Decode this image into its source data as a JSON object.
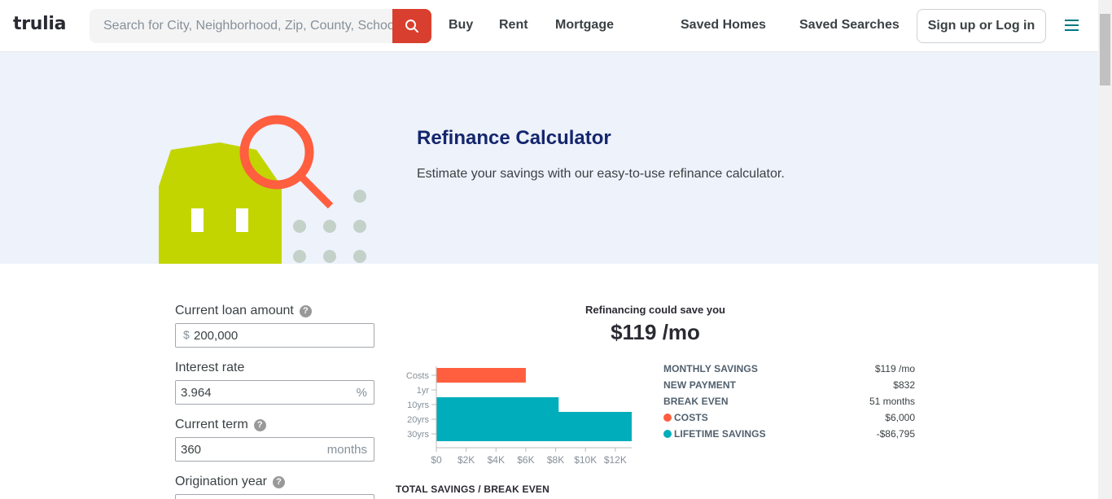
{
  "header": {
    "logo": "trulia",
    "search_placeholder": "Search for City, Neighborhood, Zip, County, School",
    "nav": [
      "Buy",
      "Rent",
      "Mortgage",
      "Saved Homes",
      "Saved Searches"
    ],
    "signup_label": "Sign up or Log in"
  },
  "hero": {
    "title": "Refinance Calculator",
    "subtitle": "Estimate your savings with our easy-to-use refinance calculator."
  },
  "form": {
    "loan_label": "Current loan amount",
    "loan_prefix": "$",
    "loan_value": "200,000",
    "rate_label": "Interest rate",
    "rate_value": "3.964",
    "rate_suffix": "%",
    "term_label": "Current term",
    "term_value": "360",
    "term_suffix": "months",
    "year_label": "Origination year",
    "help": "?"
  },
  "results": {
    "headline_label": "Refinancing could save you",
    "headline_value": "$119 /mo",
    "summary": [
      {
        "label": "MONTHLY SAVINGS",
        "value": "$119 /mo"
      },
      {
        "label": "NEW PAYMENT",
        "value": "$832"
      },
      {
        "label": "BREAK EVEN",
        "value": "51 months"
      },
      {
        "label": "COSTS",
        "value": "$6,000"
      },
      {
        "label": "LIFETIME SAVINGS",
        "value": "-$86,795"
      }
    ],
    "total_title": "TOTAL SAVINGS / BREAK EVEN"
  },
  "colors": {
    "costs": "#ff5e3f",
    "savings": "#00adbb",
    "brand_red": "#d93f2e",
    "title_navy": "#15266d"
  },
  "chart_data": {
    "type": "bar",
    "orientation": "horizontal",
    "categories": [
      "Costs",
      "1yr",
      "10yrs",
      "20yrs",
      "30yrs"
    ],
    "series": [
      {
        "values": [
          6000,
          0,
          8200,
          13100,
          13100
        ],
        "colors": [
          "#ff5e3f",
          "#00adbb",
          "#00adbb",
          "#00adbb",
          "#00adbb"
        ]
      }
    ],
    "x_ticks": [
      "$0",
      "$2K",
      "$4K",
      "$6K",
      "$8K",
      "$10K",
      "$12K"
    ],
    "xlim": [
      0,
      13100
    ]
  }
}
